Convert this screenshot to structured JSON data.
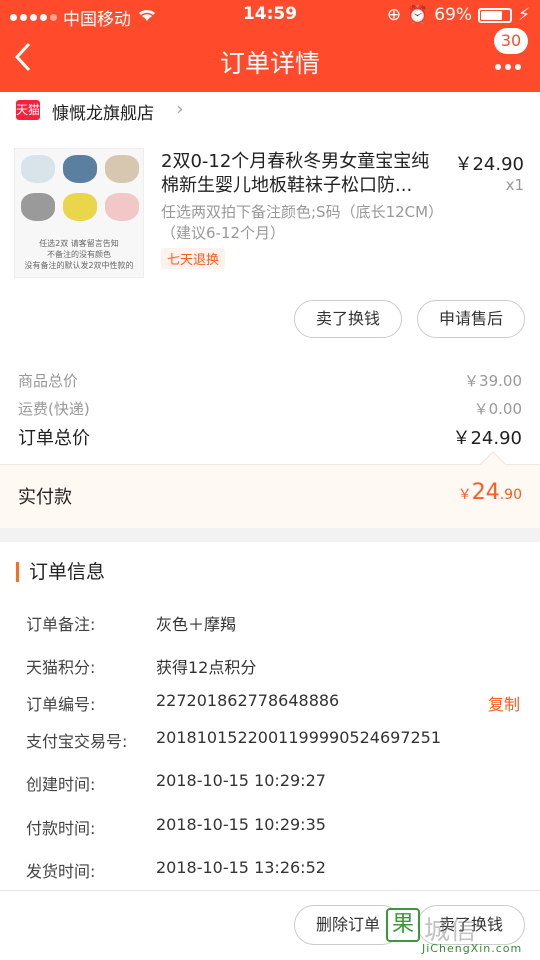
{
  "status_bar": {
    "carrier": "中国移动",
    "time": "14:59",
    "battery_percent": "69%"
  },
  "nav": {
    "title": "订单详情",
    "back_icon": "chevron-left-icon",
    "more_icon": "more-dots-icon",
    "badge_count": "30"
  },
  "store": {
    "name": "慷慨龙旗舰店",
    "platform_badge": "天猫"
  },
  "product": {
    "title": "2双0-12个月春秋冬男女童宝宝纯棉新生婴儿地板鞋袜子松口防...",
    "price": "￥24.90",
    "quantity": "x1",
    "sku": "任选两双拍下备注颜色;S码（底长12CM）（建议6-12个月）",
    "tag": "七天退换",
    "thumb_caption": "任选2双 请客留言告知\n不备注的没有颜色\n没有备注的默认发2双中性款的",
    "buttons": {
      "sell": "卖了换钱",
      "after_sale": "申请售后"
    }
  },
  "summary": {
    "goods_total_label": "商品总价",
    "goods_total_value": "￥39.00",
    "shipping_label": "运费(快递)",
    "shipping_value": "￥0.00",
    "order_total_label": "订单总价",
    "order_total_value": "￥24.90",
    "paid_label": "实付款",
    "paid_currency": "￥",
    "paid_int": "24",
    "paid_dec": ".90"
  },
  "order_info": {
    "heading": "订单信息",
    "rows": [
      {
        "label": "订单备注:",
        "value": "灰色＋摩羯"
      },
      {
        "label": "天猫积分:",
        "value": "获得12点积分"
      },
      {
        "label": "订单编号:",
        "value": "227201862778648886"
      },
      {
        "label": "支付宝交易号:",
        "value": "2018101522001199990524697251"
      },
      {
        "label": "创建时间:",
        "value": "2018-10-15 10:29:27"
      },
      {
        "label": "付款时间:",
        "value": "2018-10-15 10:29:35"
      },
      {
        "label": "发货时间:",
        "value": "2018-10-15 13:26:52"
      }
    ],
    "copy_label": "复制"
  },
  "bottom_bar": {
    "delete": "删除订单",
    "sell": "卖了换钱"
  },
  "watermark": {
    "box": "果",
    "text": "城信",
    "url": "JiChengXin.com"
  },
  "colors": {
    "brand": "#ff4b2b",
    "accent": "#ff5a1f"
  }
}
